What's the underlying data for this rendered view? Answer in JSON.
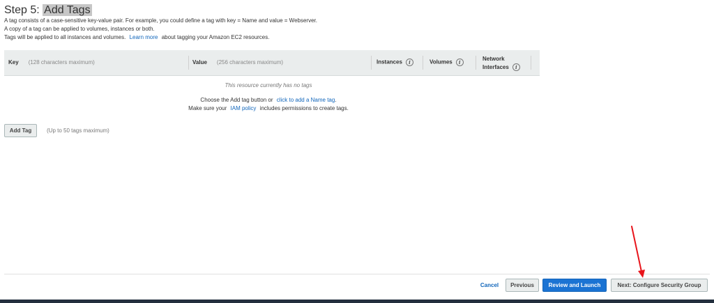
{
  "page": {
    "step_prefix": "Step 5: ",
    "step_title": "Add Tags"
  },
  "description": {
    "line1": "A tag consists of a case-sensitive key-value pair. For example, you could define a tag with key = Name and value = Webserver.",
    "line2": "A copy of a tag can be applied to volumes, instances or both.",
    "line3_prefix": "Tags will be applied to all instances and volumes.",
    "learn_more": "Learn more",
    "line3_suffix": "about tagging your Amazon EC2 resources."
  },
  "table": {
    "key_header": "Key",
    "key_hint": "(128 characters maximum)",
    "value_header": "Value",
    "value_hint": "(256 characters maximum)",
    "instances_header": "Instances",
    "volumes_header": "Volumes",
    "network_header_line1": "Network",
    "network_header_line2": "Interfaces",
    "info_glyph": "i",
    "empty_message": "This resource currently has no tags",
    "choose_prefix": "Choose the Add tag button or",
    "choose_link": "click to add a Name tag",
    "choose_suffix": ".",
    "iam_prefix": "Make sure your",
    "iam_link": "IAM policy",
    "iam_suffix": "includes permissions to create tags."
  },
  "add_tag": {
    "button": "Add Tag",
    "note": "(Up to 50 tags maximum)"
  },
  "footer": {
    "cancel": "Cancel",
    "previous": "Previous",
    "review_launch": "Review and Launch",
    "next": "Next: Configure Security Group"
  },
  "colors": {
    "primary": "#1b73d3",
    "link": "#1166bb",
    "annotation_arrow": "#e8141b",
    "header_bg": "#eaeded"
  },
  "icons": {
    "info": "info-icon",
    "annotation": "red-arrow-annotation"
  }
}
